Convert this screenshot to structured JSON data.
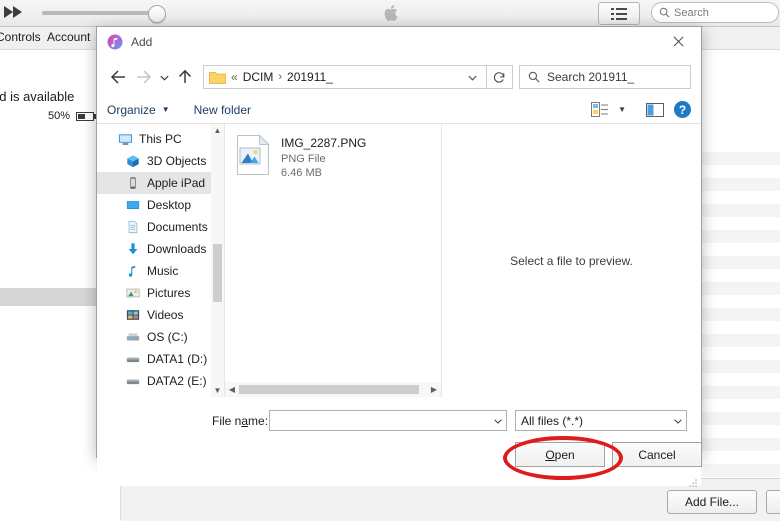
{
  "background_app": {
    "name": "iTunes",
    "toolbar": {
      "forward_icon": "fast-forward-icon",
      "volume_slider_value": "max",
      "apple_logo": "apple-logo",
      "list_view_icon": "list-view-icon",
      "search_placeholder": "Search",
      "search_icon": "search-icon"
    },
    "menus": [
      {
        "label": "Controls"
      },
      {
        "label": "Account"
      }
    ],
    "status": {
      "update_text": "ad is available",
      "battery_percent": "50%",
      "battery_icon": "battery-icon"
    },
    "footer": {
      "add_file_label": "Add File..."
    }
  },
  "dialog": {
    "title": "Add",
    "title_icon": "itunes-icon",
    "close_icon": "close-icon",
    "nav": {
      "back_icon": "arrow-left-icon",
      "forward_icon": "arrow-right-icon",
      "recent_icon": "chevron-down-icon",
      "up_icon": "arrow-up-icon",
      "folder_icon": "folder-icon",
      "breadcrumb_overflow": "«",
      "breadcrumbs": [
        "DCIM",
        "201911_"
      ],
      "breadcrumb_separator": "›",
      "address_dropdown_icon": "chevron-down-icon",
      "refresh_icon": "refresh-icon",
      "search_icon": "search-icon",
      "search_placeholder": "Search 201911_",
      "search_value": "Search 201911_"
    },
    "commands": {
      "organize_label": "Organize",
      "organize_caret_icon": "caret-down-icon",
      "new_folder_label": "New folder",
      "view_options_icon": "view-options-icon",
      "view_caret_icon": "caret-down-icon",
      "preview_pane_icon": "preview-pane-icon",
      "help_icon": "help-icon",
      "help_label": "?"
    },
    "nav_pane": {
      "scroll_up_icon": "chevron-up-icon",
      "scroll_down_icon": "chevron-down-icon",
      "items": [
        {
          "label": "This PC",
          "icon": "monitor-icon",
          "level": 1,
          "selected": false
        },
        {
          "label": "3D Objects",
          "icon": "cube-icon",
          "level": 2,
          "selected": false
        },
        {
          "label": "Apple iPad",
          "icon": "tablet-icon",
          "level": 2,
          "selected": true
        },
        {
          "label": "Desktop",
          "icon": "desktop-icon",
          "level": 2,
          "selected": false
        },
        {
          "label": "Documents",
          "icon": "document-icon",
          "level": 2,
          "selected": false
        },
        {
          "label": "Downloads",
          "icon": "download-icon",
          "level": 2,
          "selected": false
        },
        {
          "label": "Music",
          "icon": "music-note-icon",
          "level": 2,
          "selected": false
        },
        {
          "label": "Pictures",
          "icon": "picture-icon",
          "level": 2,
          "selected": false
        },
        {
          "label": "Videos",
          "icon": "video-icon",
          "level": 2,
          "selected": false
        },
        {
          "label": "OS (C:)",
          "icon": "harddrive-icon",
          "level": 2,
          "selected": false
        },
        {
          "label": "DATA1 (D:)",
          "icon": "drive-icon",
          "level": 2,
          "selected": false
        },
        {
          "label": "DATA2 (E:)",
          "icon": "drive-icon",
          "level": 2,
          "selected": false
        }
      ]
    },
    "file_list": {
      "files": [
        {
          "name": "IMG_2287.PNG",
          "type": "PNG File",
          "size": "6.46 MB",
          "icon": "image-file-icon"
        }
      ],
      "hscroll_left_icon": "chevron-left-icon",
      "hscroll_right_icon": "chevron-right-icon"
    },
    "preview": {
      "message": "Select a file to preview."
    },
    "footer": {
      "file_name_label": "File name:",
      "file_name_value": "",
      "file_name_dropdown_icon": "chevron-down-icon",
      "filter_value": "All files (*.*)",
      "filter_dropdown_icon": "chevron-down-icon",
      "open_label": "Open",
      "cancel_label": "Cancel",
      "resize_grip_icon": "resize-grip-icon"
    },
    "annotation": {
      "shape": "ellipse",
      "color": "#e01b1b",
      "target": "open-button"
    }
  }
}
